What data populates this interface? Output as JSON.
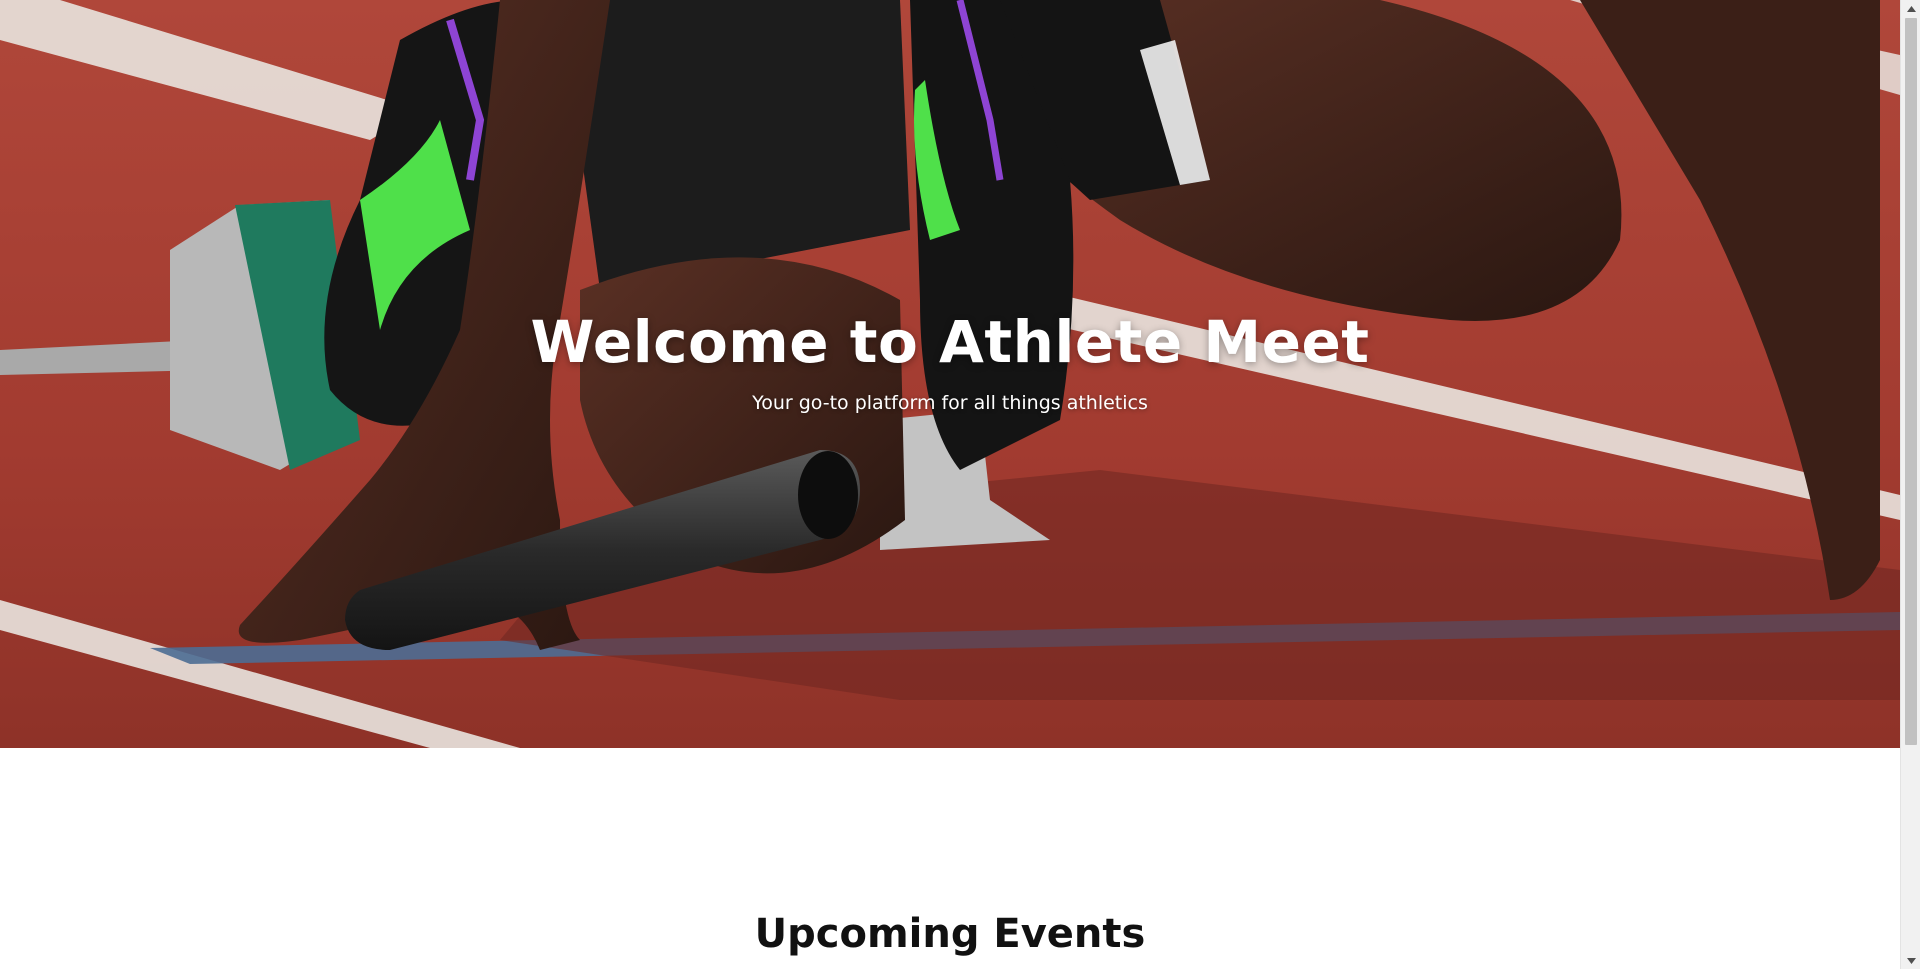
{
  "hero": {
    "title": "Welcome to Athlete Meet",
    "subtitle": "Your go-to platform for all things athletics",
    "image": "sprinter-in-starting-blocks-with-relay-baton"
  },
  "events": {
    "heading": "Upcoming Events"
  },
  "colors": {
    "track": "#a33a2f",
    "lane_line": "#e9e4df",
    "shoe_accent": "#4fe04a",
    "heading_text": "#111111"
  },
  "scrollbar": {
    "up_icon": "triangle-up-icon",
    "down_icon": "triangle-down-icon"
  }
}
